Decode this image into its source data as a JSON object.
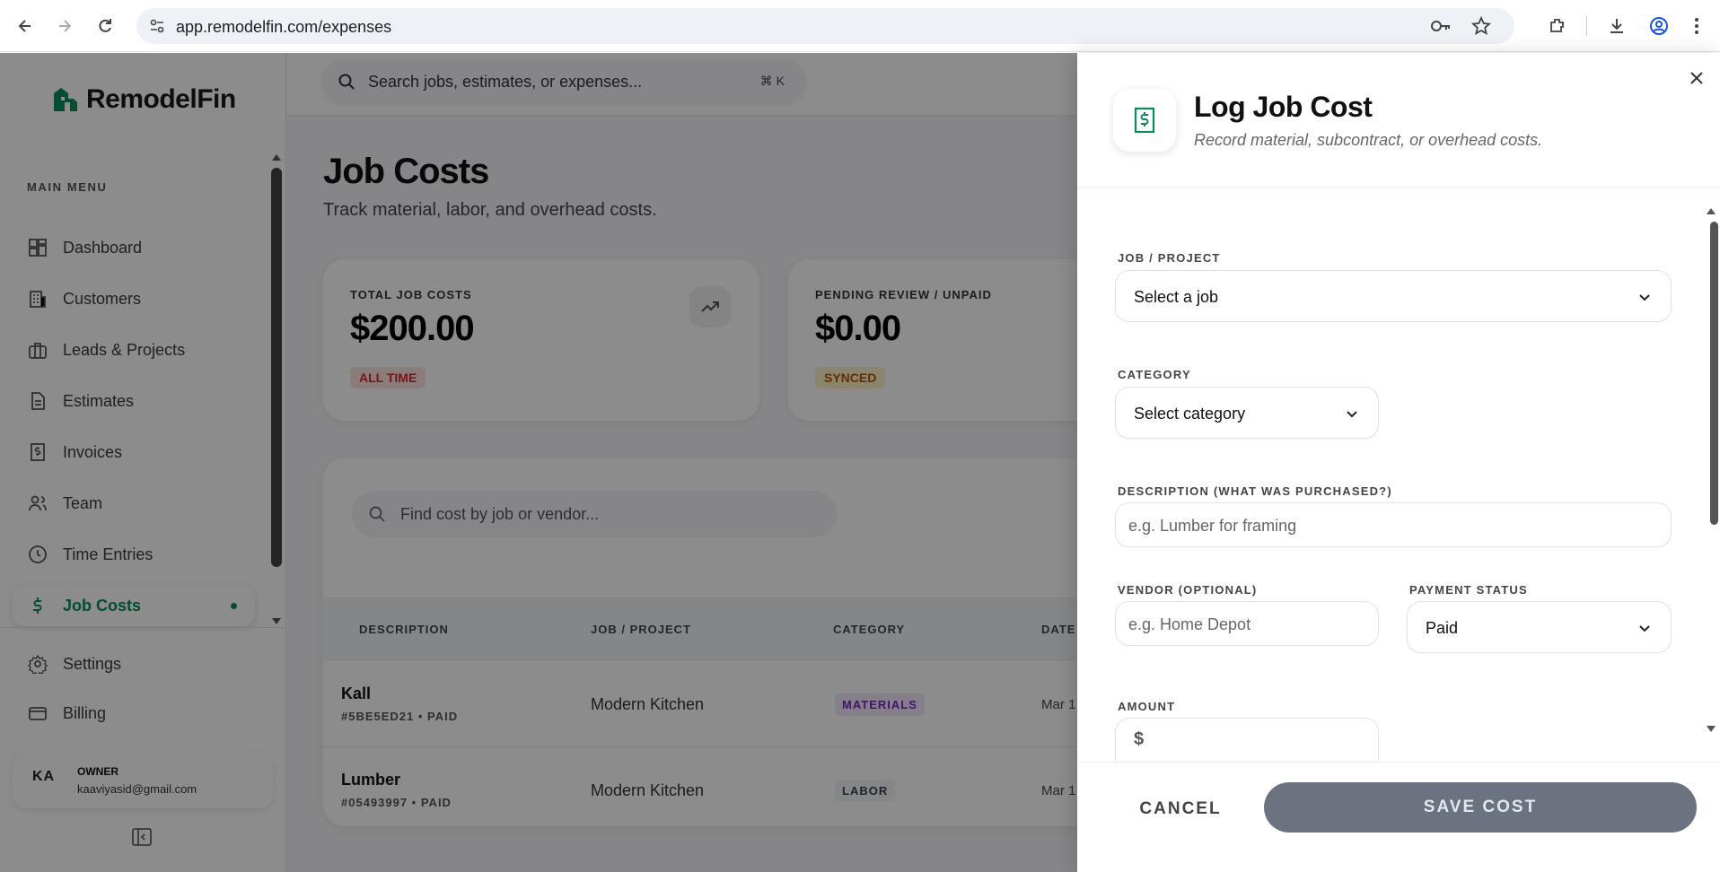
{
  "browser": {
    "url": "app.remodelfin.com/expenses"
  },
  "sidebar": {
    "brand": "RemodelFin",
    "menu_title": "MAIN MENU",
    "items": [
      {
        "label": "Dashboard",
        "icon": "grid-icon"
      },
      {
        "label": "Customers",
        "icon": "building-icon"
      },
      {
        "label": "Leads & Projects",
        "icon": "briefcase-icon"
      },
      {
        "label": "Estimates",
        "icon": "document-icon"
      },
      {
        "label": "Invoices",
        "icon": "dollar-receipt-icon"
      },
      {
        "label": "Team",
        "icon": "users-icon"
      },
      {
        "label": "Time Entries",
        "icon": "clock-icon"
      },
      {
        "label": "Job Costs",
        "icon": "dollar-icon",
        "active": true
      }
    ],
    "bottom_items": [
      {
        "label": "Settings",
        "icon": "gear-icon"
      },
      {
        "label": "Billing",
        "icon": "credit-card-icon"
      }
    ],
    "user": {
      "initials": "KA",
      "role": "OWNER",
      "email": "kaaviyasid@gmail.com"
    }
  },
  "topbar": {
    "search_placeholder": "Search jobs, estimates, or expenses...",
    "shortcut": "⌘ K"
  },
  "page": {
    "title": "Job Costs",
    "subtitle": "Track material, labor, and overhead costs."
  },
  "stats": [
    {
      "label": "TOTAL JOB COSTS",
      "value": "$200.00",
      "badge": "ALL TIME",
      "badge_color": "#dc2626"
    },
    {
      "label": "PENDING REVIEW / UNPAID",
      "value": "$0.00",
      "badge": "SYNCED",
      "badge_color": "#d97706"
    }
  ],
  "table": {
    "search_placeholder": "Find cost by job or vendor...",
    "columns": [
      "DESCRIPTION",
      "JOB / PROJECT",
      "CATEGORY",
      "DATE"
    ],
    "rows": [
      {
        "title": "Kall",
        "sub": "#5BE5ED21 • PAID",
        "job": "Modern Kitchen",
        "category": "MATERIALS",
        "cat_color": "#7e22ce",
        "date": "Mar 1"
      },
      {
        "title": "Lumber",
        "sub": "#05493997 • PAID",
        "job": "Modern Kitchen",
        "category": "LABOR",
        "cat_color": "#374151",
        "date": "Mar 1"
      }
    ]
  },
  "panel": {
    "title": "Log Job Cost",
    "subtitle": "Record material, subcontract, or overhead costs.",
    "fields": {
      "job_label": "JOB / PROJECT",
      "job_value": "Select a job",
      "category_label": "CATEGORY",
      "category_value": "Select category",
      "description_label": "DESCRIPTION (WHAT WAS PURCHASED?)",
      "description_placeholder": "e.g. Lumber for framing",
      "vendor_label": "VENDOR (OPTIONAL)",
      "vendor_placeholder": "e.g. Home Depot",
      "payment_label": "PAYMENT STATUS",
      "payment_value": "Paid",
      "amount_label": "AMOUNT",
      "amount_prefix": "$"
    },
    "cancel_label": "CANCEL",
    "save_label": "SAVE COST"
  },
  "colors": {
    "brand": "#0a8a58",
    "save_button": "#6b7280"
  }
}
